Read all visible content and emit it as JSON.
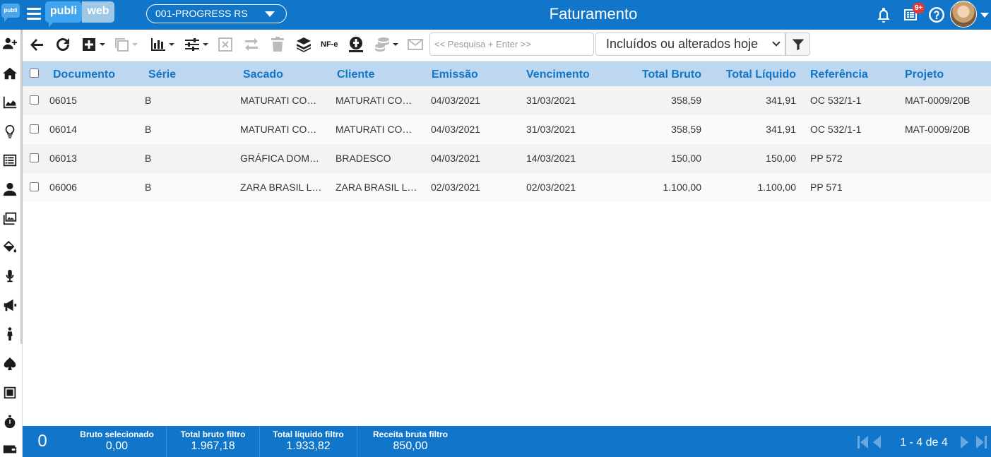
{
  "sidebar": {
    "logo_text": "publi",
    "items": [
      {
        "icon": "add-user-icon"
      },
      {
        "icon": "home-icon"
      },
      {
        "icon": "area-chart-icon"
      },
      {
        "icon": "lightbulb-icon"
      },
      {
        "icon": "list-icon"
      },
      {
        "icon": "user-tie-icon"
      },
      {
        "icon": "images-icon"
      },
      {
        "icon": "paint-bucket-icon"
      },
      {
        "icon": "microphone-icon"
      },
      {
        "icon": "megaphone-icon"
      },
      {
        "icon": "person-icon"
      },
      {
        "icon": "spade-icon"
      },
      {
        "icon": "stop-icon"
      },
      {
        "icon": "stopwatch-icon"
      },
      {
        "icon": "wallet-icon"
      }
    ]
  },
  "topbar": {
    "logo_publi": "publi",
    "logo_web": "web",
    "company": "001-PROGRESS RS",
    "title": "Faturamento",
    "notification_badge": "9+"
  },
  "toolbar": {
    "nfe_label": "NF-e",
    "search_placeholder": "<< Pesquisa + Enter >>",
    "search_value": "",
    "filter_selected": "Incluídos ou alterados hoje"
  },
  "table": {
    "columns": [
      "Documento",
      "Série",
      "Sacado",
      "Cliente",
      "Emissão",
      "Vencimento",
      "Total Bruto",
      "Total Líquido",
      "Referência",
      "Projeto"
    ],
    "rows": [
      {
        "documento": "06015",
        "serie": "B",
        "sacado": "MATURATI CO…",
        "cliente": "MATURATI CO…",
        "emissao": "04/03/2021",
        "vencimento": "31/03/2021",
        "total_bruto": "358,59",
        "total_liquido": "341,91",
        "referencia": "OC 532/1-1",
        "projeto": "MAT-0009/20B"
      },
      {
        "documento": "06014",
        "serie": "B",
        "sacado": "MATURATI CO…",
        "cliente": "MATURATI CO…",
        "emissao": "04/03/2021",
        "vencimento": "31/03/2021",
        "total_bruto": "358,59",
        "total_liquido": "341,91",
        "referencia": "OC 532/1-1",
        "projeto": "MAT-0009/20B"
      },
      {
        "documento": "06013",
        "serie": "B",
        "sacado": "GRÁFICA DOM…",
        "cliente": "BRADESCO",
        "emissao": "04/03/2021",
        "vencimento": "14/03/2021",
        "total_bruto": "150,00",
        "total_liquido": "150,00",
        "referencia": "PP 572",
        "projeto": ""
      },
      {
        "documento": "06006",
        "serie": "B",
        "sacado": "ZARA BRASIL L…",
        "cliente": "ZARA BRASIL L…",
        "emissao": "02/03/2021",
        "vencimento": "02/03/2021",
        "total_bruto": "1.100,00",
        "total_liquido": "1.100,00",
        "referencia": "PP 571",
        "projeto": ""
      }
    ]
  },
  "footer": {
    "selected_count": "0",
    "summaries": [
      {
        "label": "Bruto selecionado",
        "value": "0,00"
      },
      {
        "label": "Total bruto filtro",
        "value": "1.967,18"
      },
      {
        "label": "Total líquido filtro",
        "value": "1.933,82"
      },
      {
        "label": "Receita bruta filtro",
        "value": "850,00"
      }
    ],
    "page_info": "1 - 4 de 4"
  },
  "colors": {
    "primary": "#1176c9",
    "header_row": "#bcd7ef",
    "badge": "#e53935"
  }
}
